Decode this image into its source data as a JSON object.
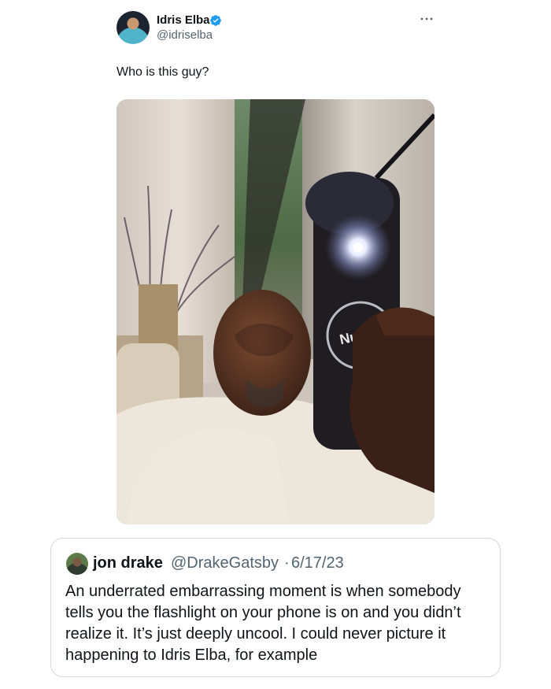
{
  "tweet": {
    "author_name": "Idris Elba",
    "author_handle": "@idriselba",
    "text": "Who is this guy?",
    "more_icon": "more-horizontal-icon",
    "verified_icon": "verified-badge-icon",
    "verified_color": "#1d9bf0"
  },
  "quote": {
    "author_name": "jon drake",
    "author_handle": "@DrakeGatsby",
    "separator": "·",
    "date": "6/17/23",
    "text": "An underrated embarrassing moment is when somebody tells you the flashlight on your phone is on and you didn’t realize it. It’s just deeply uncool. I could never picture it happening to Idris Elba, for example"
  },
  "colors": {
    "text_primary": "#0f1419",
    "text_secondary": "#536471",
    "border": "#cfd9de"
  }
}
